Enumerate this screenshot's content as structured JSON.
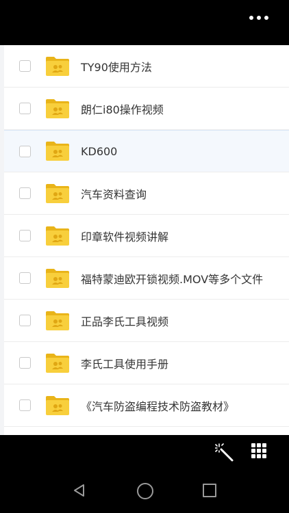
{
  "files": [
    {
      "name": "TY90使用方法"
    },
    {
      "name": "朗仁i80操作视频"
    },
    {
      "name": "KD600"
    },
    {
      "name": "汽车资料查询"
    },
    {
      "name": "印章软件视频讲解"
    },
    {
      "name": "福特蒙迪欧开锁视频.MOV等多个文件"
    },
    {
      "name": "正品李氏工具视频"
    },
    {
      "name": "李氏工具使用手册"
    },
    {
      "name": "《汽车防盗编程技术防盗教材》"
    }
  ],
  "icons": {
    "folder": "shared-folder-icon",
    "more": "more-options-icon",
    "wand": "magic-wand-icon",
    "grid": "grid-menu-icon"
  },
  "colors": {
    "folder": "#f8cf3c",
    "folder_dark": "#e9b419",
    "highlight_row": "#f4f8fd"
  }
}
